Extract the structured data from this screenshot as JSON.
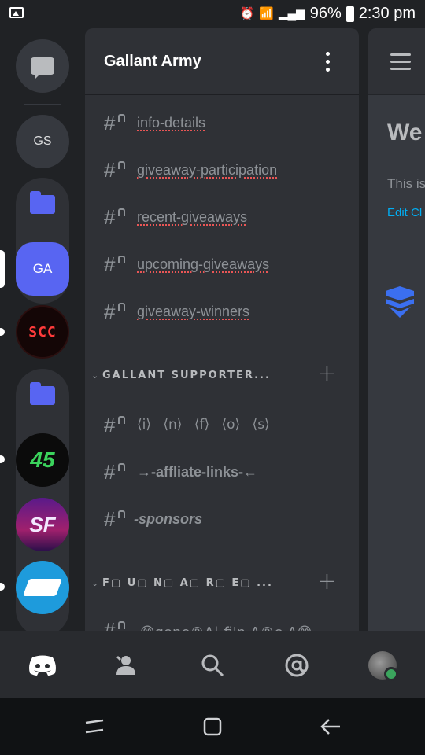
{
  "status_bar": {
    "battery": "96%",
    "time": "2:30 pm"
  },
  "rail": {
    "gs_label": "GS",
    "ga_label": "GA",
    "scc_label": "SCC",
    "g45_label": "45",
    "sf_label": "SF"
  },
  "server": {
    "title": "Gallant Army"
  },
  "channels_top": [
    {
      "name": "info-details"
    },
    {
      "name": "giveaway-participation"
    },
    {
      "name": "recent-giveaways"
    },
    {
      "name": "upcoming-giveaways"
    },
    {
      "name": "giveaway-winners"
    }
  ],
  "category1": {
    "name": "GALLANT SUPPORTER..."
  },
  "channels_mid": [
    {
      "name": "⟨i⟩ ⟨n⟩ ⟨f⟩ ⟨o⟩ ⟨s⟩"
    },
    {
      "name": "→-affliate-links-←"
    },
    {
      "name": "-sponsors"
    }
  ],
  "category2": {
    "name": "F▢ U▢ N▢ A▢ R▢ E▢ ..."
  },
  "partial_channel": "😁gene®A|-fi'n-A®e A😁",
  "peek": {
    "heading": "We",
    "text": "This is",
    "edit": "Edit Cl"
  },
  "bottom_nav": {
    "items": [
      "home-icon",
      "friends-icon",
      "search-icon",
      "mentions-icon",
      "profile-avatar"
    ]
  },
  "colors": {
    "blurple": "#5865f2",
    "bg": "#202225",
    "panel": "#2f3136",
    "online": "#3ba55d"
  }
}
